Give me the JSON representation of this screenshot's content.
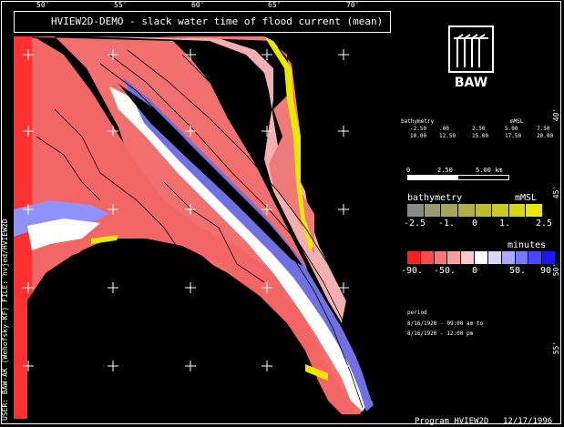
{
  "title": "HVIEW2D-DEMO  -  slack water time of flood current (mean)",
  "side_text": "USER: BAW-AK (Wehofsky-KF)   FILE: hvjed/HVIEW2D",
  "program_label": "Program  HVIEW2D",
  "date_label": "12/17/1996",
  "logo_text": "BAW",
  "top_ticks": [
    "50'",
    "55'",
    "60'",
    "65'",
    "70'"
  ],
  "right_ticks": [
    "40'",
    "45'",
    "50'",
    "55'"
  ],
  "bathymetry_table": {
    "label": "bathymetry",
    "unit": "mMSL",
    "row1": [
      "-2.50",
      ".00",
      "2.50",
      "5.00",
      "7.50"
    ],
    "row2": [
      "10.00",
      "12.50",
      "15.00",
      "17.50",
      "20.00"
    ]
  },
  "scale_bar": {
    "labels": [
      "0",
      "2.50",
      "5.00 km"
    ]
  },
  "bathymetry_legend": {
    "title": "bathymetry",
    "unit": "mMSL",
    "labels": [
      "-2.5",
      "-1.",
      "0",
      "1.",
      "2.5"
    ],
    "colors": [
      "#8a8a8a",
      "#9a9a70",
      "#a7a75b",
      "#b0b046",
      "#bcbc32",
      "#caca20",
      "#d8d810",
      "#e8e800"
    ]
  },
  "minutes_legend": {
    "title": "minutes",
    "labels": [
      "-90.",
      "-50.",
      "0",
      "50.",
      "90"
    ],
    "colors": [
      "#ff2020",
      "#ff4a4a",
      "#ff7474",
      "#ff9e9e",
      "#ffc8c8",
      "#ffffff",
      "#d8d8ff",
      "#aaaaff",
      "#7878ff",
      "#4848ff",
      "#1818ff"
    ]
  },
  "info": {
    "heading": "period",
    "line1": "8/16/1920 - 09:00 am to",
    "line2": "8/16/1920 - 12:00 pm"
  }
}
